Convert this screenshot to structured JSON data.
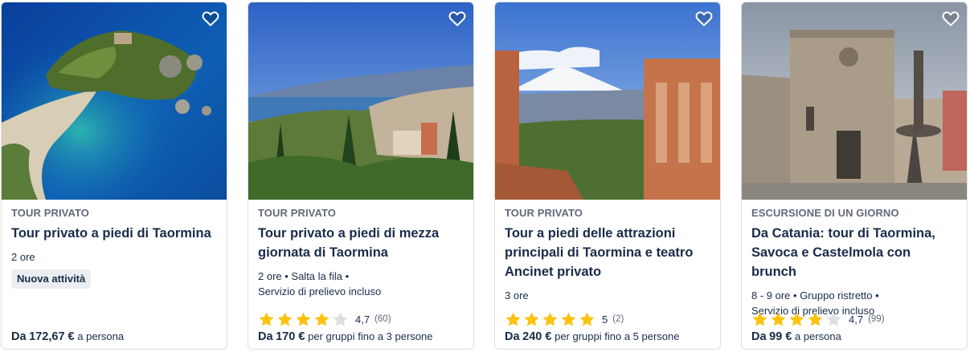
{
  "colors": {
    "text": "#1a2b49",
    "muted": "#63687a",
    "star_full": "#fdc20e",
    "star_empty": "#dcdfe4",
    "badge_bg": "#ebeef1"
  },
  "icons": {
    "favorite": "heart-outline-icon",
    "rating": "star-icon"
  },
  "cards": [
    {
      "category": "TOUR PRIVATO",
      "title": "Tour privato a piedi di Taormina",
      "meta_line1": "2 ore",
      "meta_line2": "",
      "badge": "Nuova attività",
      "rating_value": "",
      "rating_count": "",
      "stars": 0,
      "price_prefix": "Da",
      "price_amount": "172,67 €",
      "price_suffix": "a persona"
    },
    {
      "category": "TOUR PRIVATO",
      "title": "Tour privato a piedi di mezza giornata di Taormina",
      "meta_line1": "2 ore • Salta la fila •",
      "meta_line2": "Servizio di prelievo incluso",
      "badge": "",
      "rating_value": "4,7",
      "rating_count": "(60)",
      "stars": 4,
      "price_prefix": "Da",
      "price_amount": "170 €",
      "price_suffix": "per gruppi fino a 3 persone"
    },
    {
      "category": "TOUR PRIVATO",
      "title": "Tour a piedi delle attrazioni principali di Taormina e teatro Ancinet privato",
      "meta_line1": "3 ore",
      "meta_line2": "",
      "badge": "",
      "rating_value": "5",
      "rating_count": "(2)",
      "stars": 5,
      "price_prefix": "Da",
      "price_amount": "240 €",
      "price_suffix": "per gruppi fino a 5 persone"
    },
    {
      "category": "ESCURSIONE DI UN GIORNO",
      "title": "Da Catania: tour di Taormina, Savoca e Castelmola con brunch",
      "meta_line1": "8 - 9 ore • Gruppo ristretto •",
      "meta_line2": "Servizio di prelievo incluso",
      "badge": "",
      "rating_value": "4,7",
      "rating_count": "(99)",
      "stars": 4,
      "price_prefix": "Da",
      "price_amount": "99 €",
      "price_suffix": "a persona"
    }
  ]
}
